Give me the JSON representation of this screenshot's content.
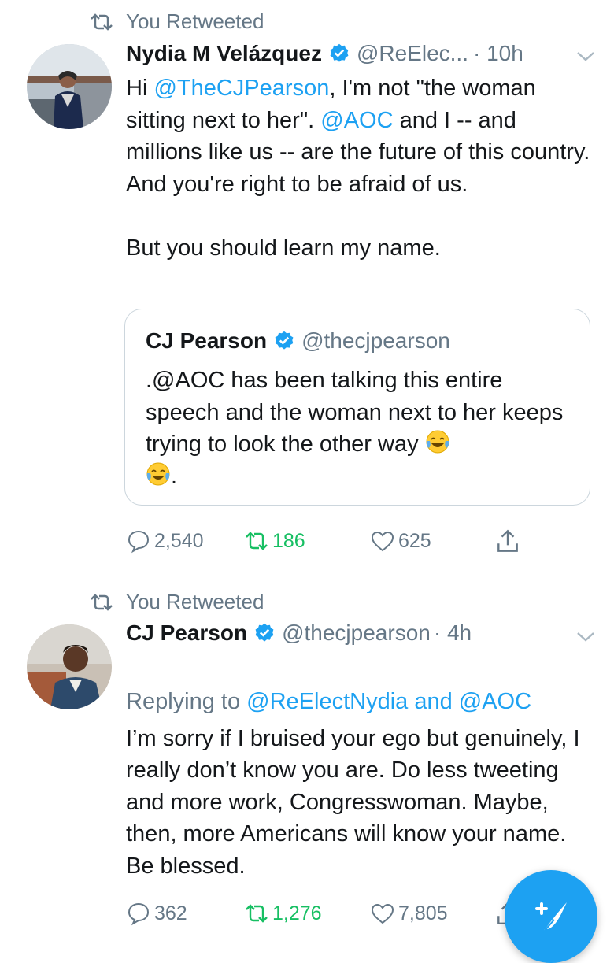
{
  "tweets": [
    {
      "retweet_label": "You Retweeted",
      "name": "Nydia M Velázquez",
      "handle": "@ReElec...",
      "time": "· 10h",
      "text_parts": [
        "Hi ",
        "@TheCJPearson",
        ", I'm not \"the woman sitting next to her\". ",
        "@AOC",
        " and I -- and millions like us -- are the future of this country. And you're right to be afraid of us.\n\nBut you should learn my name."
      ],
      "quote": {
        "name": "CJ Pearson",
        "handle": "@thecjpearson",
        "text": ".@AOC has been talking this entire speech and the woman next to her keeps trying to look the other way"
      },
      "replies": "2,540",
      "retweets": "186",
      "likes": "625"
    },
    {
      "retweet_label": "You Retweeted",
      "name": "CJ Pearson",
      "handle": "@thecjpearson",
      "time": "· 4h",
      "replying_prefix": "Replying to ",
      "replying_to": "@ReElectNydia and @AOC",
      "text": "I’m sorry if I bruised your ego but genuinely, I really don’t know you are. Do less tweeting and more work, Congresswoman. Maybe, then, more Americans will know your name. Be blessed.",
      "replies": "362",
      "retweets": "1,276",
      "likes": "7,805"
    }
  ],
  "icons": {
    "retweeted": "retweet-icon",
    "verified": "verified-badge-icon",
    "more": "chevron-down-icon",
    "reply": "reply-icon",
    "retweet": "retweet-icon",
    "like": "heart-icon",
    "share": "share-icon",
    "emoji": "face-with-tears-of-joy-emoji",
    "compose": "compose-tweet-icon"
  },
  "colors": {
    "link": "#1da1f2",
    "retweet_active": "#17bf63",
    "secondary_text": "#657786",
    "compose_button": "#1da1f2"
  }
}
